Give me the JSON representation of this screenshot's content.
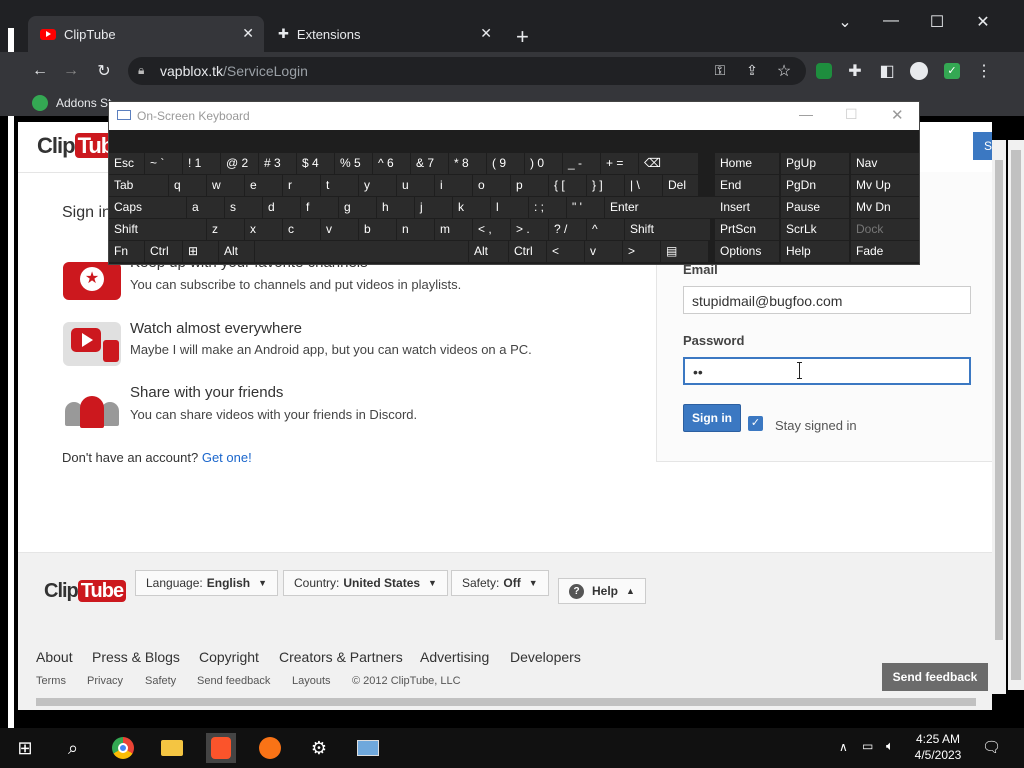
{
  "tabs": [
    {
      "label": "ClipTube"
    },
    {
      "label": "Extensions"
    }
  ],
  "address": {
    "host": "vapblox.tk",
    "path": "/ServiceLogin"
  },
  "bookmarks": {
    "first": "Addons St"
  },
  "osk": {
    "title": "On-Screen Keyboard",
    "rows": [
      [
        "Esc",
        "~ `",
        "! 1",
        "@ 2",
        "# 3",
        "$ 4",
        "% 5",
        "^ 6",
        "& 7",
        "* 8",
        "( 9",
        ") 0",
        "_ -",
        "+ =",
        "⌫"
      ],
      [
        "Tab",
        "q",
        "w",
        "e",
        "r",
        "t",
        "y",
        "u",
        "i",
        "o",
        "p",
        "{ [",
        "} ]",
        "| \\",
        "Del"
      ],
      [
        "Caps",
        "a",
        "s",
        "d",
        "f",
        "g",
        "h",
        "j",
        "k",
        "l",
        ": ;",
        "\" '",
        "Enter"
      ],
      [
        "Shift",
        "z",
        "x",
        "c",
        "v",
        "b",
        "n",
        "m",
        "< ,",
        "> .",
        "? /",
        "^",
        "Shift"
      ],
      [
        "Fn",
        "Ctrl",
        "⊞",
        "Alt",
        "",
        "Alt",
        "Ctrl",
        "<",
        "v",
        ">",
        "▤"
      ]
    ],
    "nav": [
      [
        "Home",
        "PgUp",
        "Nav"
      ],
      [
        "End",
        "PgDn",
        "Mv Up"
      ],
      [
        "Insert",
        "Pause",
        "Mv Dn"
      ],
      [
        "PrtScn",
        "ScrLk",
        "Dock"
      ],
      [
        "Options",
        "Help",
        "Fade"
      ]
    ]
  },
  "page": {
    "logo": "ClipTube",
    "signin_heading": "Sign in",
    "features": [
      {
        "title": "Keep up with your favorite channels",
        "desc": "You can subscribe to channels and put videos in playlists."
      },
      {
        "title": "Watch almost everywhere",
        "desc": "Maybe I will make an Android app, but you can watch videos on a PC."
      },
      {
        "title": "Share with your friends",
        "desc": "You can share videos with your friends in Discord."
      }
    ],
    "no_account": "Don't have an account?",
    "get_one": "Get one!",
    "form": {
      "email_label": "Email",
      "email_value": "stupidmail@bugfoo.com",
      "password_label": "Password",
      "password_value": "••",
      "signin_button": "Sign in",
      "stay_signed_in": "Stay signed in"
    },
    "header_button": "S"
  },
  "footer": {
    "logo": "ClipTube",
    "language_label": "Language:",
    "language_value": "English",
    "country_label": "Country:",
    "country_value": "United States",
    "safety_label": "Safety:",
    "safety_value": "Off",
    "help": "Help",
    "links": [
      "About",
      "Press & Blogs",
      "Copyright",
      "Creators & Partners",
      "Advertising",
      "Developers"
    ],
    "small_links": [
      "Terms",
      "Privacy",
      "Safety",
      "Send feedback",
      "Layouts"
    ],
    "copyright": "© 2012 ClipTube, LLC",
    "send_feedback": "Send feedback"
  },
  "taskbar": {
    "time": "4:25 AM",
    "date": "4/5/2023"
  },
  "colors": {
    "accent": "#3b78c2",
    "brand_red": "#cc181e"
  }
}
